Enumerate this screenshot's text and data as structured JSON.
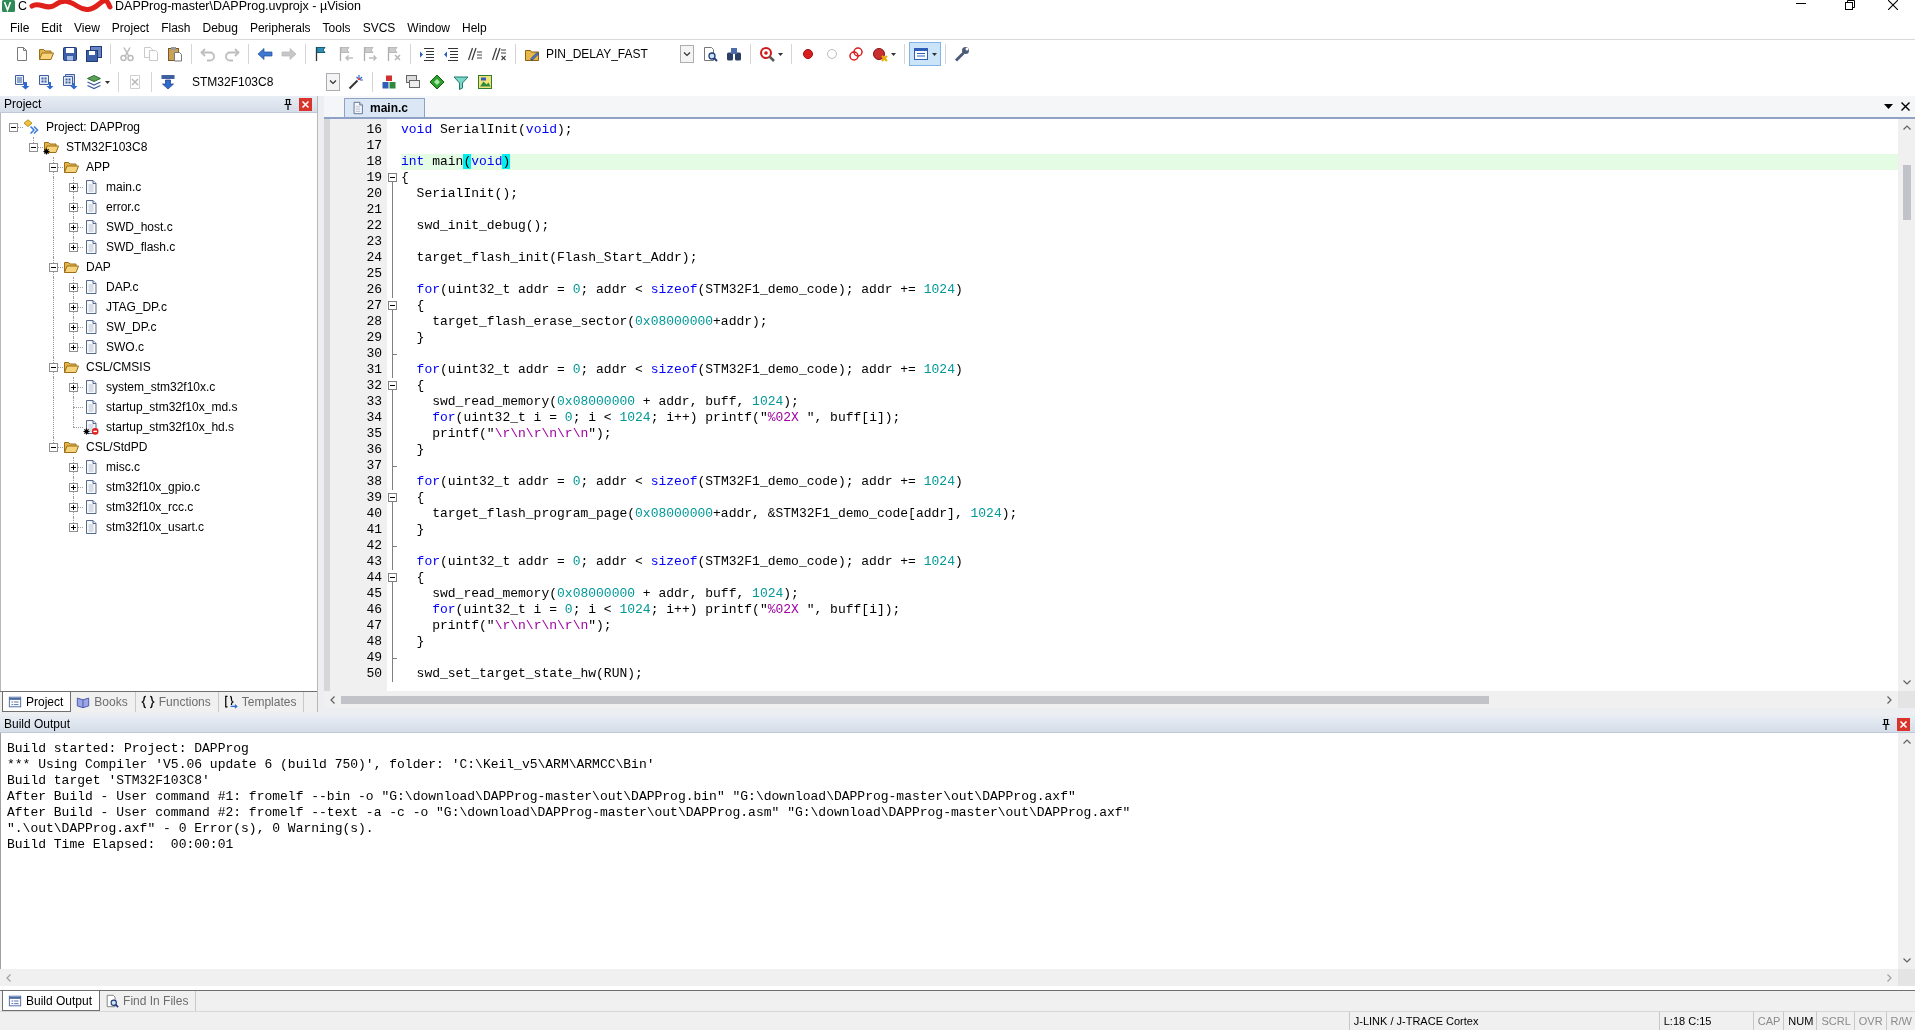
{
  "window": {
    "title_lead": "C",
    "title": "DAPProg-master\\DAPProg.uvprojx - µVision"
  },
  "menu": [
    "File",
    "Edit",
    "View",
    "Project",
    "Flash",
    "Debug",
    "Peripherals",
    "Tools",
    "SVCS",
    "Window",
    "Help"
  ],
  "toolbar_1": {
    "left": [
      [
        {
          "kind": "new",
          "disabled": false,
          "pressed": false
        },
        {
          "kind": "open",
          "disabled": false,
          "pressed": false
        },
        {
          "kind": "save",
          "disabled": false,
          "pressed": false
        },
        {
          "kind": "saveall",
          "disabled": false,
          "pressed": false
        }
      ],
      [
        {
          "kind": "cut",
          "disabled": true,
          "pressed": false
        },
        {
          "kind": "copy",
          "disabled": true,
          "pressed": false
        },
        {
          "kind": "paste",
          "disabled": false,
          "pressed": false
        }
      ],
      [
        {
          "kind": "undo",
          "disabled": true,
          "pressed": false
        },
        {
          "kind": "redo",
          "disabled": true,
          "pressed": false
        }
      ],
      [
        {
          "kind": "back",
          "disabled": false,
          "pressed": false
        },
        {
          "kind": "forward",
          "disabled": true,
          "pressed": false
        }
      ],
      [
        {
          "kind": "bookmark",
          "disabled": false,
          "pressed": false
        },
        {
          "kind": "bmprev",
          "disabled": true,
          "pressed": false
        },
        {
          "kind": "bmnext",
          "disabled": true,
          "pressed": false
        },
        {
          "kind": "bmclear",
          "disabled": true,
          "pressed": false
        }
      ],
      [
        {
          "kind": "indent",
          "disabled": false,
          "pressed": false
        },
        {
          "kind": "unindent",
          "disabled": false,
          "pressed": false
        },
        {
          "kind": "comment",
          "disabled": false,
          "pressed": false
        },
        {
          "kind": "uncomment",
          "disabled": false,
          "pressed": false
        }
      ],
      [
        {
          "kind": "config",
          "disabled": false,
          "pressed": false
        }
      ]
    ],
    "combo": "PIN_DELAY_FAST",
    "right": [
      [
        {
          "kind": "findfiles",
          "disabled": false,
          "pressed": false
        },
        {
          "kind": "find",
          "disabled": false,
          "pressed": false
        }
      ],
      [
        {
          "kind": "debug",
          "disabled": false,
          "pressed": false
        }
      ],
      [
        {
          "kind": "breakpoint",
          "disabled": false,
          "pressed": false
        },
        {
          "kind": "bpdisable",
          "disabled": true,
          "pressed": false
        },
        {
          "kind": "bptoggle",
          "disabled": false,
          "pressed": false
        },
        {
          "kind": "bpkill",
          "disabled": false,
          "pressed": false
        }
      ],
      [
        {
          "kind": "window",
          "disabled": false,
          "pressed": true
        }
      ],
      [
        {
          "kind": "wrench",
          "disabled": false,
          "pressed": false
        }
      ]
    ]
  },
  "toolbar_2": {
    "left": [
      [
        {
          "kind": "translate",
          "disabled": false,
          "pressed": false
        },
        {
          "kind": "build",
          "disabled": false,
          "pressed": false
        },
        {
          "kind": "rebuild",
          "disabled": false,
          "pressed": false
        },
        {
          "kind": "batch",
          "disabled": false,
          "pressed": false
        }
      ],
      [
        {
          "kind": "stop",
          "disabled": true,
          "pressed": false
        }
      ],
      [
        {
          "kind": "load",
          "disabled": false,
          "pressed": false
        }
      ]
    ],
    "combo": "STM32F103C8",
    "right": [
      [
        {
          "kind": "wand",
          "disabled": false,
          "pressed": false
        }
      ],
      [
        {
          "kind": "components",
          "disabled": false,
          "pressed": false
        },
        {
          "kind": "windows",
          "disabled": false,
          "pressed": false
        },
        {
          "kind": "diamond",
          "disabled": false,
          "pressed": false
        },
        {
          "kind": "funnel",
          "disabled": false,
          "pressed": false
        },
        {
          "kind": "pack",
          "disabled": false,
          "pressed": false
        }
      ]
    ]
  },
  "project_panel": {
    "title": "Project",
    "tree": [
      {
        "label": "Project: DAPProg",
        "kind": "project",
        "expanded": true,
        "children": [
          {
            "label": "STM32F103C8",
            "kind": "target",
            "expanded": true,
            "children": [
              {
                "label": "APP",
                "kind": "group",
                "expanded": true,
                "children": [
                  {
                    "label": "main.c",
                    "kind": "file",
                    "expanded": false,
                    "excluded": false
                  },
                  {
                    "label": "error.c",
                    "kind": "file",
                    "expanded": false,
                    "excluded": false
                  },
                  {
                    "label": "SWD_host.c",
                    "kind": "file",
                    "expanded": false,
                    "excluded": false
                  },
                  {
                    "label": "SWD_flash.c",
                    "kind": "file",
                    "expanded": false,
                    "excluded": false
                  }
                ]
              },
              {
                "label": "DAP",
                "kind": "group",
                "expanded": true,
                "children": [
                  {
                    "label": "DAP.c",
                    "kind": "file",
                    "expanded": false,
                    "excluded": false
                  },
                  {
                    "label": "JTAG_DP.c",
                    "kind": "file",
                    "expanded": false,
                    "excluded": false
                  },
                  {
                    "label": "SW_DP.c",
                    "kind": "file",
                    "expanded": false,
                    "excluded": false
                  },
                  {
                    "label": "SWO.c",
                    "kind": "file",
                    "expanded": false,
                    "excluded": false
                  }
                ]
              },
              {
                "label": "CSL/CMSIS",
                "kind": "group",
                "expanded": true,
                "children": [
                  {
                    "label": "system_stm32f10x.c",
                    "kind": "file",
                    "expanded": false,
                    "excluded": false
                  },
                  {
                    "label": "startup_stm32f10x_md.s",
                    "kind": "file",
                    "excluded": false
                  },
                  {
                    "label": "startup_stm32f10x_hd.s",
                    "kind": "file",
                    "excluded": true
                  }
                ]
              },
              {
                "label": "CSL/StdPD",
                "kind": "group",
                "expanded": true,
                "children": [
                  {
                    "label": "misc.c",
                    "kind": "file",
                    "expanded": false,
                    "excluded": false
                  },
                  {
                    "label": "stm32f10x_gpio.c",
                    "kind": "file",
                    "expanded": false,
                    "excluded": false
                  },
                  {
                    "label": "stm32f10x_rcc.c",
                    "kind": "file",
                    "expanded": false,
                    "excluded": false
                  },
                  {
                    "label": "stm32f10x_usart.c",
                    "kind": "file",
                    "expanded": false,
                    "excluded": false
                  }
                ]
              }
            ]
          }
        ]
      }
    ],
    "tabs": [
      {
        "label": "Project",
        "kind": "project",
        "selected": true
      },
      {
        "label": "Books",
        "kind": "books",
        "selected": false
      },
      {
        "label": "Functions",
        "kind": "functions",
        "selected": false
      },
      {
        "label": "Templates",
        "kind": "templates",
        "selected": false
      }
    ]
  },
  "editor": {
    "tabs": [
      {
        "label": "main.c",
        "selected": true
      }
    ],
    "lines": [
      {
        "number": "16",
        "kind": "plain",
        "current": false,
        "tokens": [
          {
            "kind": "keyword",
            "text": "void"
          },
          {
            "kind": "plain",
            "text": " SerialInit("
          },
          {
            "kind": "keyword",
            "text": "void"
          },
          {
            "kind": "plain",
            "text": ");"
          }
        ]
      },
      {
        "number": "17",
        "kind": "plain",
        "current": false
      },
      {
        "number": "18",
        "kind": "plain",
        "current": true,
        "tokens": [
          {
            "kind": "keyword",
            "text": "int"
          },
          {
            "kind": "plain",
            "text": " main"
          },
          {
            "kind": "brace",
            "text": "("
          },
          {
            "kind": "keyword",
            "text": "void"
          },
          {
            "kind": "brace",
            "text": ")"
          }
        ]
      },
      {
        "number": "19",
        "kind": "fold_start",
        "current": false,
        "tokens": [
          {
            "kind": "plain",
            "text": "{"
          }
        ]
      },
      {
        "number": "20",
        "kind": "fold_body",
        "current": false,
        "tokens": [
          {
            "kind": "plain",
            "text": "  SerialInit();"
          }
        ]
      },
      {
        "number": "21",
        "kind": "fold_body",
        "current": false
      },
      {
        "number": "22",
        "kind": "fold_body",
        "current": false,
        "tokens": [
          {
            "kind": "plain",
            "text": "  swd_init_debug();"
          }
        ]
      },
      {
        "number": "23",
        "kind": "fold_body",
        "current": false
      },
      {
        "number": "24",
        "kind": "fold_body",
        "current": false,
        "tokens": [
          {
            "kind": "plain",
            "text": "  target_flash_init(Flash_Start_Addr);"
          }
        ]
      },
      {
        "number": "25",
        "kind": "fold_body",
        "current": false
      },
      {
        "number": "26",
        "kind": "fold_body",
        "current": false,
        "tokens": [
          {
            "kind": "keyword",
            "text": "  for"
          },
          {
            "kind": "plain",
            "text": "(uint32_t addr = "
          },
          {
            "kind": "number",
            "text": "0"
          },
          {
            "kind": "plain",
            "text": "; addr < "
          },
          {
            "kind": "keyword",
            "text": "sizeof"
          },
          {
            "kind": "plain",
            "text": "(STM32F1_demo_code); addr += "
          },
          {
            "kind": "number",
            "text": "1024"
          },
          {
            "kind": "plain",
            "text": ")"
          }
        ]
      },
      {
        "number": "27",
        "kind": "fold_start",
        "current": false,
        "tokens": [
          {
            "kind": "plain",
            "text": "  {"
          }
        ]
      },
      {
        "number": "28",
        "kind": "fold_body",
        "current": false,
        "tokens": [
          {
            "kind": "plain",
            "text": "    target_flash_erase_sector("
          },
          {
            "kind": "number",
            "text": "0x08000000"
          },
          {
            "kind": "plain",
            "text": "+addr);"
          }
        ]
      },
      {
        "number": "29",
        "kind": "fold_body",
        "current": false,
        "tokens": [
          {
            "kind": "plain",
            "text": "  }"
          }
        ]
      },
      {
        "number": "30",
        "kind": "fold_end",
        "current": false
      },
      {
        "number": "31",
        "kind": "fold_body",
        "current": false,
        "tokens": [
          {
            "kind": "keyword",
            "text": "  for"
          },
          {
            "kind": "plain",
            "text": "(uint32_t addr = "
          },
          {
            "kind": "number",
            "text": "0"
          },
          {
            "kind": "plain",
            "text": "; addr < "
          },
          {
            "kind": "keyword",
            "text": "sizeof"
          },
          {
            "kind": "plain",
            "text": "(STM32F1_demo_code); addr += "
          },
          {
            "kind": "number",
            "text": "1024"
          },
          {
            "kind": "plain",
            "text": ")"
          }
        ]
      },
      {
        "number": "32",
        "kind": "fold_start",
        "current": false,
        "tokens": [
          {
            "kind": "plain",
            "text": "  {"
          }
        ]
      },
      {
        "number": "33",
        "kind": "fold_body",
        "current": false,
        "tokens": [
          {
            "kind": "plain",
            "text": "    swd_read_memory("
          },
          {
            "kind": "number",
            "text": "0x08000000"
          },
          {
            "kind": "plain",
            "text": " + addr, buff, "
          },
          {
            "kind": "number",
            "text": "1024"
          },
          {
            "kind": "plain",
            "text": ");"
          }
        ]
      },
      {
        "number": "34",
        "kind": "fold_body",
        "current": false,
        "tokens": [
          {
            "kind": "keyword",
            "text": "    for"
          },
          {
            "kind": "plain",
            "text": "(uint32_t i = "
          },
          {
            "kind": "number",
            "text": "0"
          },
          {
            "kind": "plain",
            "text": "; i < "
          },
          {
            "kind": "number",
            "text": "1024"
          },
          {
            "kind": "plain",
            "text": "; i++) printf(\""
          },
          {
            "kind": "string",
            "text": "%02X "
          },
          {
            "kind": "plain",
            "text": "\", buff[i]);"
          }
        ]
      },
      {
        "number": "35",
        "kind": "fold_body",
        "current": false,
        "tokens": [
          {
            "kind": "plain",
            "text": "    printf(\""
          },
          {
            "kind": "string",
            "text": "\\r\\n\\r\\n\\r\\n"
          },
          {
            "kind": "plain",
            "text": "\");"
          }
        ]
      },
      {
        "number": "36",
        "kind": "fold_body",
        "current": false,
        "tokens": [
          {
            "kind": "plain",
            "text": "  }"
          }
        ]
      },
      {
        "number": "37",
        "kind": "fold_end",
        "current": false
      },
      {
        "number": "38",
        "kind": "fold_body",
        "current": false,
        "tokens": [
          {
            "kind": "keyword",
            "text": "  for"
          },
          {
            "kind": "plain",
            "text": "(uint32_t addr = "
          },
          {
            "kind": "number",
            "text": "0"
          },
          {
            "kind": "plain",
            "text": "; addr < "
          },
          {
            "kind": "keyword",
            "text": "sizeof"
          },
          {
            "kind": "plain",
            "text": "(STM32F1_demo_code); addr += "
          },
          {
            "kind": "number",
            "text": "1024"
          },
          {
            "kind": "plain",
            "text": ")"
          }
        ]
      },
      {
        "number": "39",
        "kind": "fold_start",
        "current": false,
        "tokens": [
          {
            "kind": "plain",
            "text": "  {"
          }
        ]
      },
      {
        "number": "40",
        "kind": "fold_body",
        "current": false,
        "tokens": [
          {
            "kind": "plain",
            "text": "    target_flash_program_page("
          },
          {
            "kind": "number",
            "text": "0x08000000"
          },
          {
            "kind": "plain",
            "text": "+addr, &STM32F1_demo_code[addr], "
          },
          {
            "kind": "number",
            "text": "1024"
          },
          {
            "kind": "plain",
            "text": ");"
          }
        ]
      },
      {
        "number": "41",
        "kind": "fold_body",
        "current": false,
        "tokens": [
          {
            "kind": "plain",
            "text": "  }"
          }
        ]
      },
      {
        "number": "42",
        "kind": "fold_end",
        "current": false
      },
      {
        "number": "43",
        "kind": "fold_body",
        "current": false,
        "tokens": [
          {
            "kind": "keyword",
            "text": "  for"
          },
          {
            "kind": "plain",
            "text": "(uint32_t addr = "
          },
          {
            "kind": "number",
            "text": "0"
          },
          {
            "kind": "plain",
            "text": "; addr < "
          },
          {
            "kind": "keyword",
            "text": "sizeof"
          },
          {
            "kind": "plain",
            "text": "(STM32F1_demo_code); addr += "
          },
          {
            "kind": "number",
            "text": "1024"
          },
          {
            "kind": "plain",
            "text": ")"
          }
        ]
      },
      {
        "number": "44",
        "kind": "fold_start",
        "current": false,
        "tokens": [
          {
            "kind": "plain",
            "text": "  {"
          }
        ]
      },
      {
        "number": "45",
        "kind": "fold_body",
        "current": false,
        "tokens": [
          {
            "kind": "plain",
            "text": "    swd_read_memory("
          },
          {
            "kind": "number",
            "text": "0x08000000"
          },
          {
            "kind": "plain",
            "text": " + addr, buff, "
          },
          {
            "kind": "number",
            "text": "1024"
          },
          {
            "kind": "plain",
            "text": ");"
          }
        ]
      },
      {
        "number": "46",
        "kind": "fold_body",
        "current": false,
        "tokens": [
          {
            "kind": "keyword",
            "text": "    for"
          },
          {
            "kind": "plain",
            "text": "(uint32_t i = "
          },
          {
            "kind": "number",
            "text": "0"
          },
          {
            "kind": "plain",
            "text": "; i < "
          },
          {
            "kind": "number",
            "text": "1024"
          },
          {
            "kind": "plain",
            "text": "; i++) printf(\""
          },
          {
            "kind": "string",
            "text": "%02X "
          },
          {
            "kind": "plain",
            "text": "\", buff[i]);"
          }
        ]
      },
      {
        "number": "47",
        "kind": "fold_body",
        "current": false,
        "tokens": [
          {
            "kind": "plain",
            "text": "    printf(\""
          },
          {
            "kind": "string",
            "text": "\\r\\n\\r\\n\\r\\n"
          },
          {
            "kind": "plain",
            "text": "\");"
          }
        ]
      },
      {
        "number": "48",
        "kind": "fold_body",
        "current": false,
        "tokens": [
          {
            "kind": "plain",
            "text": "  }"
          }
        ]
      },
      {
        "number": "49",
        "kind": "fold_end",
        "current": false
      },
      {
        "number": "50",
        "kind": "fold_body",
        "current": false,
        "tokens": [
          {
            "kind": "plain",
            "text": "  swd_set_target_state_hw(RUN);"
          }
        ]
      }
    ]
  },
  "build_output": {
    "title": "Build Output",
    "lines": [
      "Build started: Project: DAPProg",
      "*** Using Compiler 'V5.06 update 6 (build 750)', folder: 'C:\\Keil_v5\\ARM\\ARMCC\\Bin'",
      "Build target 'STM32F103C8'",
      "After Build - User command #1: fromelf --bin -o \"G:\\download\\DAPProg-master\\out\\DAPProg.bin\" \"G:\\download\\DAPProg-master\\out\\DAPProg.axf\"",
      "After Build - User command #2: fromelf --text -a -c -o \"G:\\download\\DAPProg-master\\out\\DAPProg.asm\" \"G:\\download\\DAPProg-master\\out\\DAPProg.axf\"",
      "\".\\out\\DAPProg.axf\" - 0 Error(s), 0 Warning(s).",
      "Build Time Elapsed:  00:00:01"
    ]
  },
  "bottom_tabs": [
    {
      "label": "Build Output",
      "kind": "output",
      "selected": true
    },
    {
      "label": "Find In Files",
      "kind": "find",
      "selected": false
    }
  ],
  "status_bar": {
    "debugger": "J-LINK / J-TRACE Cortex",
    "cursor": "L:18 C:15",
    "indicators": [
      {
        "label": "CAP",
        "on": false
      },
      {
        "label": "NUM",
        "on": true
      },
      {
        "label": "SCRL",
        "on": false
      },
      {
        "label": "OVR",
        "on": false
      },
      {
        "label": "R/W",
        "on": false
      }
    ]
  }
}
